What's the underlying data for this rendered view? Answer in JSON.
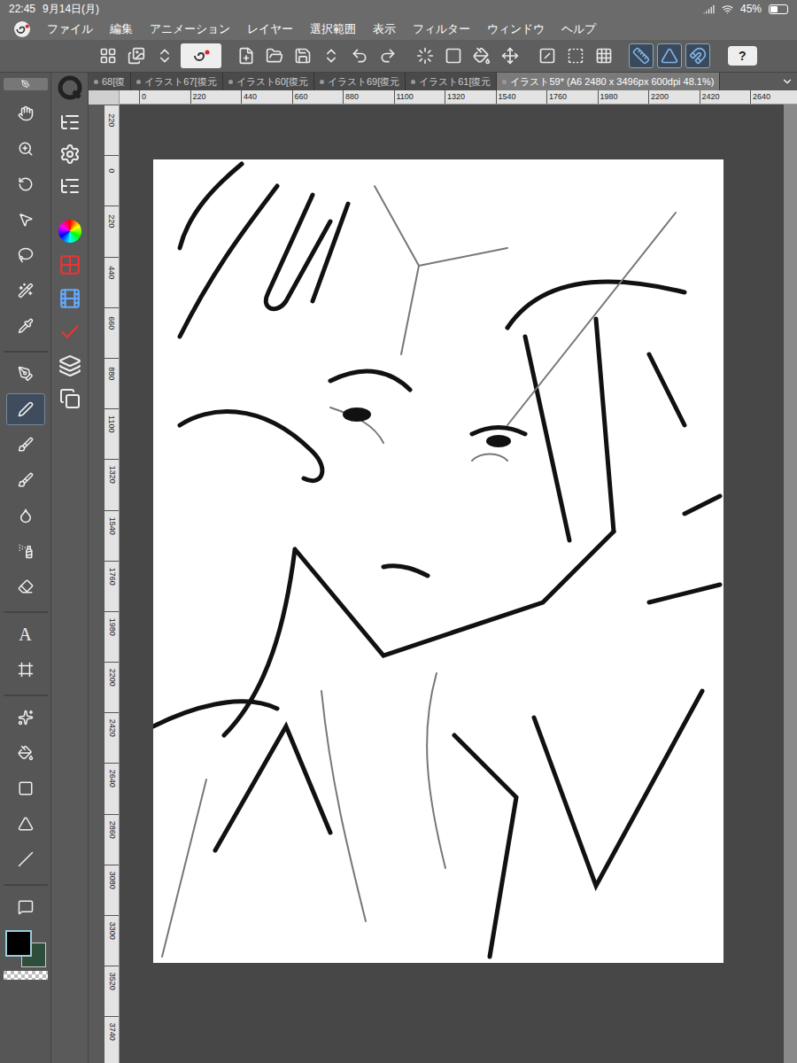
{
  "status_bar": {
    "time": "22:45",
    "date": "9月14日(月)",
    "battery": "45%",
    "battery_level": 0.45
  },
  "menu": [
    "ファイル",
    "編集",
    "アニメーション",
    "レイヤー",
    "選択範囲",
    "表示",
    "フィルター",
    "ウィンドウ",
    "ヘルプ"
  ],
  "toolbar": {
    "buttons": [
      {
        "selected": false
      },
      {
        "selected": false
      },
      {
        "selected": false
      },
      {
        "selected": true
      },
      {
        "selected": false
      },
      {
        "selected": false
      },
      {
        "selected": false
      },
      {
        "selected": false
      },
      {
        "selected": false
      },
      {
        "selected": false
      },
      {
        "selected": false
      },
      {
        "selected": false
      },
      {
        "selected": false
      },
      {
        "selected": false
      },
      {
        "selected": false
      },
      {
        "selected": false
      },
      {
        "selected": false
      },
      {
        "selected": true
      },
      {
        "selected": true
      },
      {
        "selected": true
      }
    ],
    "help": "?"
  },
  "tabs": [
    {
      "label": "68[復",
      "selected": false
    },
    {
      "label": "イラスト67[復元",
      "selected": false
    },
    {
      "label": "イラスト60[復元",
      "selected": false
    },
    {
      "label": "イラスト69[復元",
      "selected": false
    },
    {
      "label": "イラスト61[復元",
      "selected": false
    },
    {
      "label": "イラスト59* (A6 2480 x 3496px 600dpi 48.1%)",
      "selected": true
    }
  ],
  "tools": [
    {
      "selected": false
    },
    {
      "selected": false
    },
    {
      "selected": false
    },
    {
      "selected": false
    },
    {
      "selected": false
    },
    {
      "selected": false
    },
    {
      "selected": false
    },
    {
      "selected": false
    },
    {
      "selected": true
    },
    {
      "selected": false
    },
    {
      "selected": false
    },
    {
      "selected": false
    },
    {
      "selected": false
    },
    {
      "selected": false
    },
    {
      "selected": false,
      "label": "A"
    },
    {
      "selected": false
    },
    {
      "selected": false
    },
    {
      "selected": false
    },
    {
      "selected": false
    },
    {
      "selected": false
    },
    {
      "selected": false
    },
    {
      "selected": false
    }
  ],
  "main_color": "#000000",
  "sub_color": "#2f4d3b",
  "ruler_top": [
    "0",
    "220",
    "440",
    "660",
    "880",
    "1100",
    "1320",
    "1540",
    "1760",
    "1980",
    "2200",
    "2420",
    "2640"
  ],
  "ruler_left": [
    "220",
    "0",
    "220",
    "440",
    "660",
    "880",
    "1100",
    "1320",
    "1540",
    "1760",
    "1980",
    "2200",
    "2420",
    "2640",
    "2860",
    "3080",
    "3300",
    "3520",
    "3740"
  ]
}
